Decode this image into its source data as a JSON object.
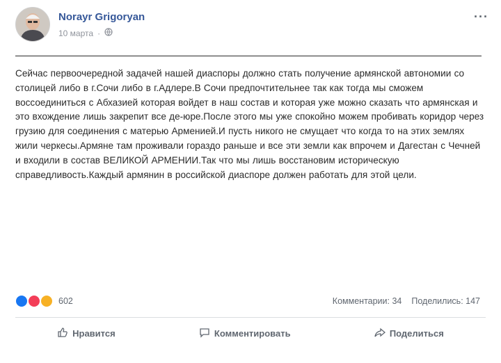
{
  "post": {
    "author": "Norayr Grigoryan",
    "date": "10 марта",
    "more_label": "···",
    "text": "Сейчас первоочередной задачей нашей диаспоры должно стать получение армянской автономии со столицей либо в г.Сочи либо в г.Адлере.В Сочи предпочтительнее так как тогда мы сможем воссоединиться с Абхазией которая войдет в наш состав и которая уже можно сказать что армянская и это вхождение лишь закрепит все де-юре.После этого мы уже спокойно можем пробивать коридор через грузию для соединения с матерью Арменией.И пусть никого не смущает что когда то на этих землях жили черкесы.Армяне там проживали гораздо раньше и все эти земли как впрочем и Дагестан с Чечней и входили в состав ВЕЛИКОЙ АРМЕНИИ.Так что мы лишь восстановим историческую справедливость.Каждый армянин в российской диаспоре должен работать для этой цели."
  },
  "stats": {
    "reactions_count": "602",
    "comments": "Комментарии: 34",
    "shares": "Поделились: 147"
  },
  "actions": {
    "like": "Нравится",
    "comment": "Комментировать",
    "share": "Поделиться"
  },
  "colors": {
    "author_link": "#365899",
    "like_blue": "#1877f2",
    "love_red": "#f33e58",
    "haha_yellow": "#f7b125"
  }
}
